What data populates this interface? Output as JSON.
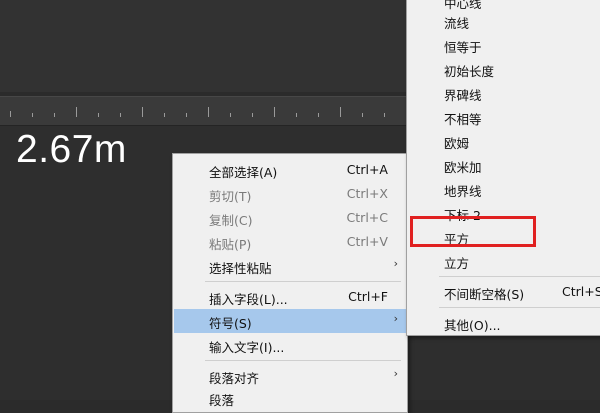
{
  "canvas": {
    "dimension_value": "2.67m"
  },
  "context_menu": {
    "items": [
      {
        "label": "全部选择(A)",
        "shortcut": "Ctrl+A",
        "enabled": true
      },
      {
        "label": "剪切(T)",
        "shortcut": "Ctrl+X",
        "enabled": false
      },
      {
        "label": "复制(C)",
        "shortcut": "Ctrl+C",
        "enabled": false
      },
      {
        "label": "粘贴(P)",
        "shortcut": "Ctrl+V",
        "enabled": false
      },
      {
        "label": "选择性粘贴",
        "chevron": "›",
        "enabled": true
      },
      {
        "label": "插入字段(L)...",
        "shortcut": "Ctrl+F",
        "enabled": true
      },
      {
        "label": "符号(S)",
        "chevron": "›",
        "enabled": true,
        "highlighted": true
      },
      {
        "label": "输入文字(I)...",
        "enabled": true
      },
      {
        "label": "段落对齐",
        "chevron": "›",
        "enabled": true
      },
      {
        "label": "段落",
        "enabled": true
      }
    ]
  },
  "symbol_submenu": {
    "items": [
      {
        "label": "中心线"
      },
      {
        "label": "流线"
      },
      {
        "label": "恒等于"
      },
      {
        "label": "初始长度"
      },
      {
        "label": "界碑线"
      },
      {
        "label": "不相等"
      },
      {
        "label": "欧姆"
      },
      {
        "label": "欧米加"
      },
      {
        "label": "地界线"
      },
      {
        "label": "下标 2"
      },
      {
        "label": "平方"
      },
      {
        "label": "立方"
      },
      {
        "label": "不间断空格(S)",
        "shortcut": "Ctrl+S"
      },
      {
        "label": "其他(O)..."
      }
    ],
    "highlighted_label": "平方"
  },
  "colors": {
    "menu_background": "#f0f0f0",
    "menu_highlight": "#a6c8ec",
    "annotation_box": "#e02020",
    "canvas_background": "#2e2e2e"
  }
}
